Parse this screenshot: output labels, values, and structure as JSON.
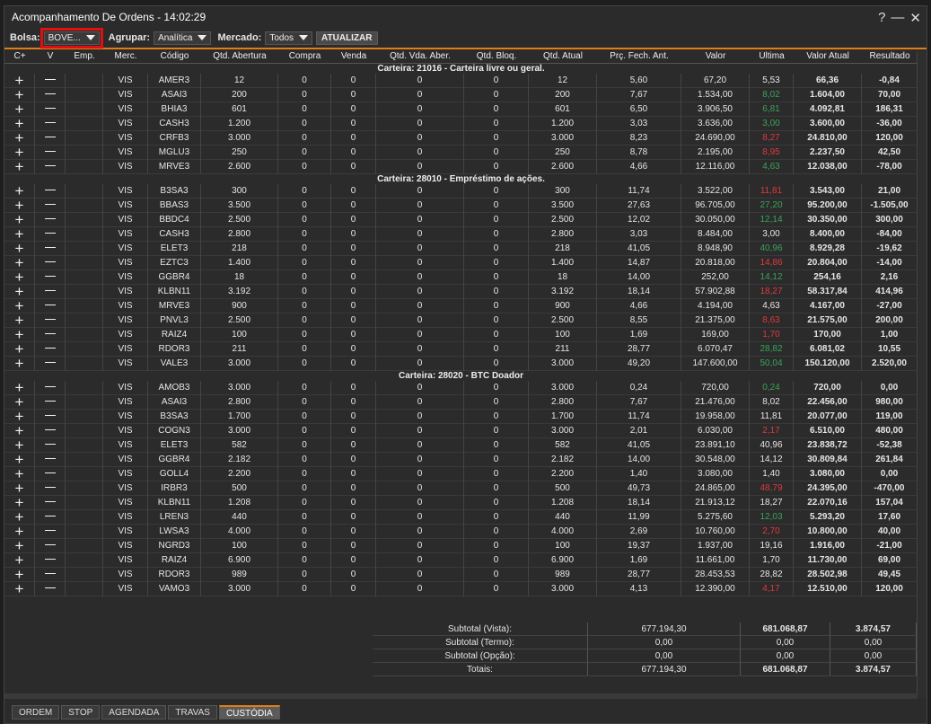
{
  "window": {
    "title": "Acompanhamento De Ordens - 14:02:29",
    "help": "?",
    "minimize": "—",
    "close": "✕"
  },
  "toolbar": {
    "bolsa_label": "Bolsa:",
    "bolsa_value": "BOVE...",
    "agrupar_label": "Agrupar:",
    "agrupar_value": "Analítica",
    "mercado_label": "Mercado:",
    "mercado_value": "Todos",
    "atualizar": "ATUALIZAR"
  },
  "columns": [
    "C+",
    "V",
    "Emp.",
    "Merc.",
    "Código",
    "Qtd. Abertura",
    "Compra",
    "Venda",
    "Qtd. Vda. Aber.",
    "Qtd. Bloq.",
    "Qtd. Atual",
    "Prç. Fech. Ant.",
    "Valor",
    "Última",
    "Valor Atual",
    "Resultado"
  ],
  "colors": {
    "up": "#3aa35a",
    "down": "#e0393e",
    "accent": "#e07d18"
  },
  "groups": [
    {
      "title": "Carteira: 21016 - Carteira livre ou geral.",
      "rows": [
        [
          "VIS",
          "AMER3",
          "12",
          "0",
          "0",
          "0",
          "0",
          "12",
          "5,60",
          "67,20",
          "5,53",
          "",
          "66,36",
          "-0,84"
        ],
        [
          "VIS",
          "ASAI3",
          "200",
          "0",
          "0",
          "0",
          "0",
          "200",
          "7,67",
          "1.534,00",
          "8,02",
          "up",
          "1.604,00",
          "70,00"
        ],
        [
          "VIS",
          "BHIA3",
          "601",
          "0",
          "0",
          "0",
          "0",
          "601",
          "6,50",
          "3.906,50",
          "6,81",
          "up",
          "4.092,81",
          "186,31"
        ],
        [
          "VIS",
          "CASH3",
          "1.200",
          "0",
          "0",
          "0",
          "0",
          "1.200",
          "3,03",
          "3.636,00",
          "3,00",
          "up",
          "3.600,00",
          "-36,00"
        ],
        [
          "VIS",
          "CRFB3",
          "3.000",
          "0",
          "0",
          "0",
          "0",
          "3.000",
          "8,23",
          "24.690,00",
          "8,27",
          "dn",
          "24.810,00",
          "120,00"
        ],
        [
          "VIS",
          "MGLU3",
          "250",
          "0",
          "0",
          "0",
          "0",
          "250",
          "8,78",
          "2.195,00",
          "8,95",
          "dn",
          "2.237,50",
          "42,50"
        ],
        [
          "VIS",
          "MRVE3",
          "2.600",
          "0",
          "0",
          "0",
          "0",
          "2.600",
          "4,66",
          "12.116,00",
          "4,63",
          "up",
          "12.038,00",
          "-78,00"
        ]
      ]
    },
    {
      "title": "Carteira: 28010 - Empréstimo de ações.",
      "rows": [
        [
          "VIS",
          "B3SA3",
          "300",
          "0",
          "0",
          "0",
          "0",
          "300",
          "11,74",
          "3.522,00",
          "11,81",
          "dn",
          "3.543,00",
          "21,00"
        ],
        [
          "VIS",
          "BBAS3",
          "3.500",
          "0",
          "0",
          "0",
          "0",
          "3.500",
          "27,63",
          "96.705,00",
          "27,20",
          "up",
          "95.200,00",
          "-1.505,00"
        ],
        [
          "VIS",
          "BBDC4",
          "2.500",
          "0",
          "0",
          "0",
          "0",
          "2.500",
          "12,02",
          "30.050,00",
          "12,14",
          "up",
          "30.350,00",
          "300,00"
        ],
        [
          "VIS",
          "CASH3",
          "2.800",
          "0",
          "0",
          "0",
          "0",
          "2.800",
          "3,03",
          "8.484,00",
          "3,00",
          "",
          "8.400,00",
          "-84,00"
        ],
        [
          "VIS",
          "ELET3",
          "218",
          "0",
          "0",
          "0",
          "0",
          "218",
          "41,05",
          "8.948,90",
          "40,96",
          "up",
          "8.929,28",
          "-19,62"
        ],
        [
          "VIS",
          "EZTC3",
          "1.400",
          "0",
          "0",
          "0",
          "0",
          "1.400",
          "14,87",
          "20.818,00",
          "14,86",
          "dn",
          "20.804,00",
          "-14,00"
        ],
        [
          "VIS",
          "GGBR4",
          "18",
          "0",
          "0",
          "0",
          "0",
          "18",
          "14,00",
          "252,00",
          "14,12",
          "up",
          "254,16",
          "2,16"
        ],
        [
          "VIS",
          "KLBN11",
          "3.192",
          "0",
          "0",
          "0",
          "0",
          "3.192",
          "18,14",
          "57.902,88",
          "18,27",
          "dn",
          "58.317,84",
          "414,96"
        ],
        [
          "VIS",
          "MRVE3",
          "900",
          "0",
          "0",
          "0",
          "0",
          "900",
          "4,66",
          "4.194,00",
          "4,63",
          "",
          "4.167,00",
          "-27,00"
        ],
        [
          "VIS",
          "PNVL3",
          "2.500",
          "0",
          "0",
          "0",
          "0",
          "2.500",
          "8,55",
          "21.375,00",
          "8,63",
          "dn",
          "21.575,00",
          "200,00"
        ],
        [
          "VIS",
          "RAIZ4",
          "100",
          "0",
          "0",
          "0",
          "0",
          "100",
          "1,69",
          "169,00",
          "1,70",
          "dn",
          "170,00",
          "1,00"
        ],
        [
          "VIS",
          "RDOR3",
          "211",
          "0",
          "0",
          "0",
          "0",
          "211",
          "28,77",
          "6.070,47",
          "28,82",
          "up",
          "6.081,02",
          "10,55"
        ],
        [
          "VIS",
          "VALE3",
          "3.000",
          "0",
          "0",
          "0",
          "0",
          "3.000",
          "49,20",
          "147.600,00",
          "50,04",
          "up",
          "150.120,00",
          "2.520,00"
        ]
      ]
    },
    {
      "title": "Carteira: 28020 - BTC Doador",
      "rows": [
        [
          "VIS",
          "AMOB3",
          "3.000",
          "0",
          "0",
          "0",
          "0",
          "3.000",
          "0,24",
          "720,00",
          "0,24",
          "up",
          "720,00",
          "0,00"
        ],
        [
          "VIS",
          "ASAI3",
          "2.800",
          "0",
          "0",
          "0",
          "0",
          "2.800",
          "7,67",
          "21.476,00",
          "8,02",
          "",
          "22.456,00",
          "980,00"
        ],
        [
          "VIS",
          "B3SA3",
          "1.700",
          "0",
          "0",
          "0",
          "0",
          "1.700",
          "11,74",
          "19.958,00",
          "11,81",
          "",
          "20.077,00",
          "119,00"
        ],
        [
          "VIS",
          "COGN3",
          "3.000",
          "0",
          "0",
          "0",
          "0",
          "3.000",
          "2,01",
          "6.030,00",
          "2,17",
          "dn",
          "6.510,00",
          "480,00"
        ],
        [
          "VIS",
          "ELET3",
          "582",
          "0",
          "0",
          "0",
          "0",
          "582",
          "41,05",
          "23.891,10",
          "40,96",
          "",
          "23.838,72",
          "-52,38"
        ],
        [
          "VIS",
          "GGBR4",
          "2.182",
          "0",
          "0",
          "0",
          "0",
          "2.182",
          "14,00",
          "30.548,00",
          "14,12",
          "",
          "30.809,84",
          "261,84"
        ],
        [
          "VIS",
          "GOLL4",
          "2.200",
          "0",
          "0",
          "0",
          "0",
          "2.200",
          "1,40",
          "3.080,00",
          "1,40",
          "",
          "3.080,00",
          "0,00"
        ],
        [
          "VIS",
          "IRBR3",
          "500",
          "0",
          "0",
          "0",
          "0",
          "500",
          "49,73",
          "24.865,00",
          "48,79",
          "dn",
          "24.395,00",
          "-470,00"
        ],
        [
          "VIS",
          "KLBN11",
          "1.208",
          "0",
          "0",
          "0",
          "0",
          "1.208",
          "18,14",
          "21.913,12",
          "18,27",
          "",
          "22.070,16",
          "157,04"
        ],
        [
          "VIS",
          "LREN3",
          "440",
          "0",
          "0",
          "0",
          "0",
          "440",
          "11,99",
          "5.275,60",
          "12,03",
          "up",
          "5.293,20",
          "17,60"
        ],
        [
          "VIS",
          "LWSA3",
          "4.000",
          "0",
          "0",
          "0",
          "0",
          "4.000",
          "2,69",
          "10.760,00",
          "2,70",
          "dn",
          "10.800,00",
          "40,00"
        ],
        [
          "VIS",
          "NGRD3",
          "100",
          "0",
          "0",
          "0",
          "0",
          "100",
          "19,37",
          "1.937,00",
          "19,16",
          "",
          "1.916,00",
          "-21,00"
        ],
        [
          "VIS",
          "RAIZ4",
          "6.900",
          "0",
          "0",
          "0",
          "0",
          "6.900",
          "1,69",
          "11.661,00",
          "1,70",
          "",
          "11.730,00",
          "69,00"
        ],
        [
          "VIS",
          "RDOR3",
          "989",
          "0",
          "0",
          "0",
          "0",
          "989",
          "28,77",
          "28.453,53",
          "28,82",
          "",
          "28.502,98",
          "49,45"
        ],
        [
          "VIS",
          "VAMO3",
          "3.000",
          "0",
          "0",
          "0",
          "0",
          "3.000",
          "4,13",
          "12.390,00",
          "4,17",
          "dn",
          "12.510,00",
          "120,00"
        ]
      ]
    }
  ],
  "totals": [
    [
      "Subtotal (Vista):",
      "677.194,30",
      "681.068,87",
      "3.874,57"
    ],
    [
      "Subtotal (Termo):",
      "0,00",
      "0,00",
      "0,00"
    ],
    [
      "Subtotal (Opção):",
      "0,00",
      "0,00",
      "0,00"
    ],
    [
      "Totais:",
      "677.194,30",
      "681.068,87",
      "3.874,57"
    ]
  ],
  "tabs": [
    "ORDEM",
    "STOP",
    "AGENDADA",
    "TRAVAS",
    "CUSTÓDIA"
  ],
  "active_tab": "CUSTÓDIA"
}
